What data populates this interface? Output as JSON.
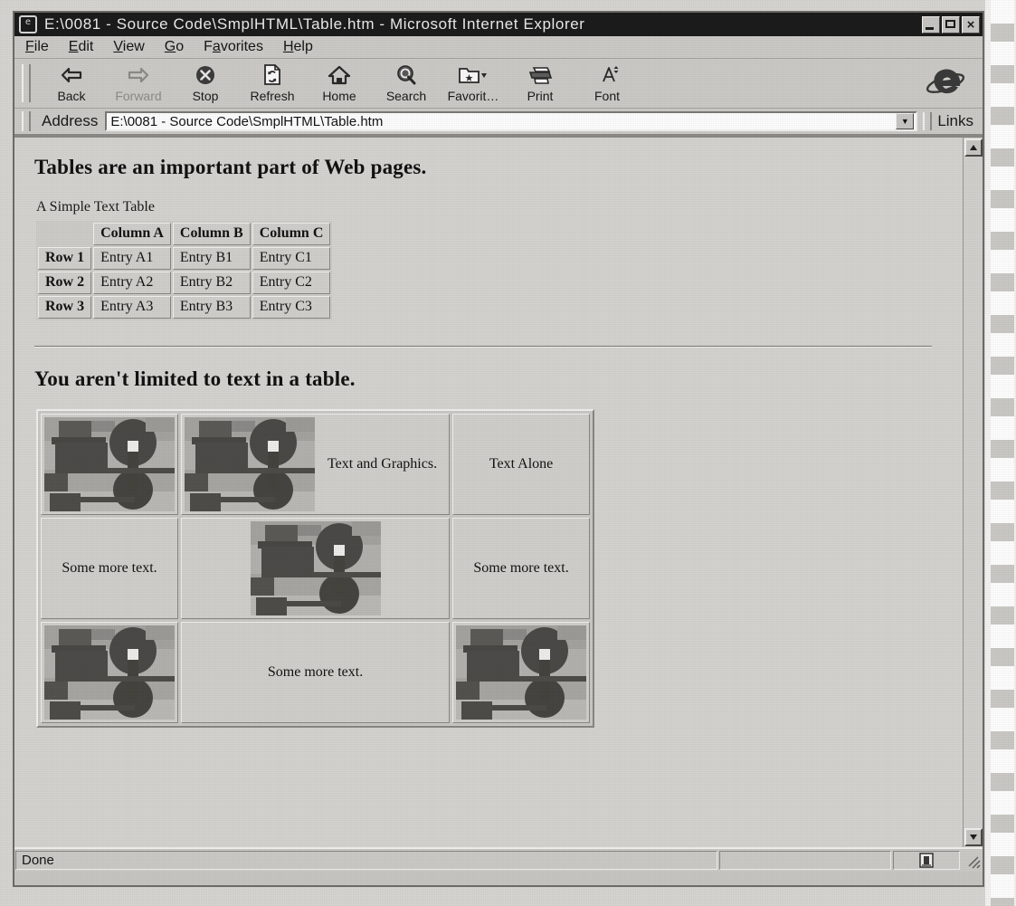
{
  "window": {
    "title": "E:\\0081 - Source Code\\SmplHTML\\Table.htm - Microsoft Internet Explorer",
    "app_icon": "ie-document-icon",
    "controls": {
      "minimize": "minimize-button",
      "maximize": "maximize-button",
      "close_glyph": "×"
    }
  },
  "menubar": {
    "items": [
      {
        "label": "File",
        "accel": "F"
      },
      {
        "label": "Edit",
        "accel": "E"
      },
      {
        "label": "View",
        "accel": "V"
      },
      {
        "label": "Go",
        "accel": "G"
      },
      {
        "label": "Favorites",
        "accel": "a"
      },
      {
        "label": "Help",
        "accel": "H"
      }
    ]
  },
  "toolbar": {
    "buttons": [
      {
        "label": "Back",
        "icon": "arrow-left-icon",
        "enabled": true
      },
      {
        "label": "Forward",
        "icon": "arrow-right-icon",
        "enabled": false
      },
      {
        "label": "Stop",
        "icon": "stop-icon",
        "enabled": true
      },
      {
        "label": "Refresh",
        "icon": "refresh-icon",
        "enabled": true
      },
      {
        "label": "Home",
        "icon": "home-icon",
        "enabled": true
      },
      {
        "label": "Search",
        "icon": "search-icon",
        "enabled": true
      },
      {
        "label": "Favorit…",
        "icon": "favorites-icon",
        "enabled": true
      },
      {
        "label": "Print",
        "icon": "printer-icon",
        "enabled": true
      },
      {
        "label": "Font",
        "icon": "font-icon",
        "enabled": true
      }
    ],
    "logo": "ie-logo-icon"
  },
  "addressbar": {
    "label": "Address",
    "value": "E:\\0081 - Source Code\\SmplHTML\\Table.htm",
    "placeholder": "",
    "dropdown_glyph": "▼",
    "links_label": "Links"
  },
  "document": {
    "heading1": "Tables are an important part of Web pages.",
    "caption1": "A Simple Text Table",
    "text_table": {
      "corner": "",
      "columns": [
        "Column A",
        "Column B",
        "Column C"
      ],
      "rows": [
        {
          "header": "Row 1",
          "cells": [
            "Entry A1",
            "Entry B1",
            "Entry C1"
          ]
        },
        {
          "header": "Row 2",
          "cells": [
            "Entry A2",
            "Entry B2",
            "Entry C2"
          ]
        },
        {
          "header": "Row 3",
          "cells": [
            "Entry A3",
            "Entry B3",
            "Entry C3"
          ]
        }
      ]
    },
    "heading2": "You aren't limited to text in a table.",
    "graphics_table": {
      "rows": [
        [
          {
            "kind": "image",
            "alt": "abstract-graphic"
          },
          {
            "kind": "image-text",
            "alt": "abstract-graphic",
            "text": "Text and Graphics."
          },
          {
            "kind": "text",
            "text": "Text Alone"
          }
        ],
        [
          {
            "kind": "text",
            "text": "Some more text."
          },
          {
            "kind": "image",
            "alt": "abstract-graphic"
          },
          {
            "kind": "text",
            "text": "Some more text."
          }
        ],
        [
          {
            "kind": "image",
            "alt": "abstract-graphic"
          },
          {
            "kind": "text",
            "text": "Some more text."
          },
          {
            "kind": "image",
            "alt": "abstract-graphic"
          }
        ]
      ]
    }
  },
  "scrollbar": {
    "up_glyph": "▲",
    "down_glyph": "▼"
  },
  "statusbar": {
    "message": "Done",
    "middle": "",
    "zone": "",
    "zone_icon": "security-zone-icon"
  },
  "colors": {
    "titlebar_bg": "#1c1c1c",
    "titlebar_text": "#ededed",
    "chrome_bg": "#cdcbc7",
    "page_bg": "#d6d4d0",
    "text": "#131313",
    "border_dark": "#8a8884",
    "border_light": "#f2f1ef"
  }
}
